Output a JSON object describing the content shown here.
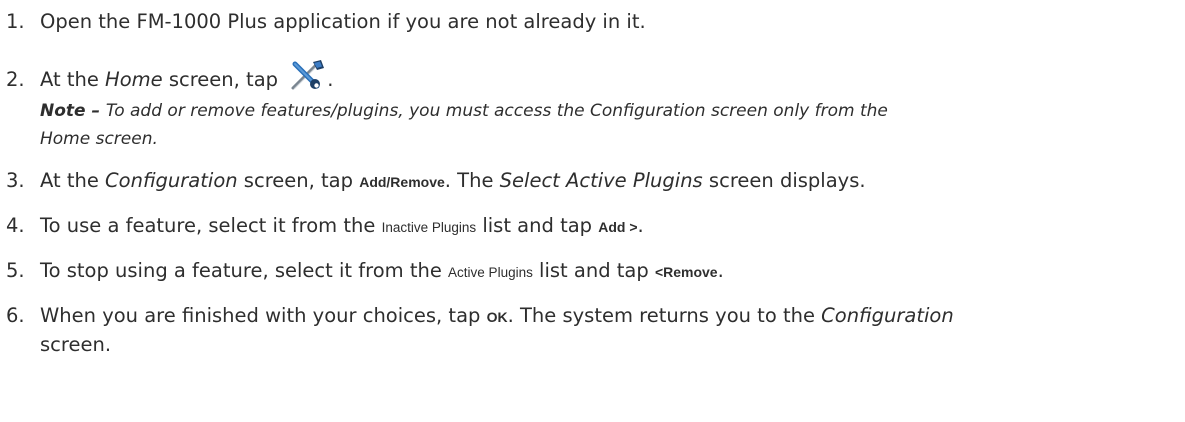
{
  "steps": [
    {
      "number": "1.",
      "text": "Open the FM-1000 Plus application if you are not already in it."
    },
    {
      "number": "2.",
      "before": "At the ",
      "screen": "Home",
      "after": " screen, tap ",
      "icon": "wrench-screwdriver-icon",
      "end": "."
    },
    {
      "number": "3.",
      "before": "At the ",
      "screen": "Configuration",
      "middle": " screen, tap ",
      "button": "Add/Remove",
      "mid2": ". The ",
      "screen2": "Select Active Plugins",
      "after": " screen displays."
    },
    {
      "number": "4.",
      "before": "To use a feature, select it from the ",
      "list": "Inactive Plugins",
      "middle": " list and tap ",
      "button": "Add >",
      "end": "."
    },
    {
      "number": "5.",
      "before": "To stop using a feature, select it from the ",
      "list": "Active Plugins",
      "middle": " list and tap ",
      "button": "<Remove",
      "end": "."
    },
    {
      "number": "6.",
      "before": "When you are finished with your choices, tap ",
      "button": "OK",
      "middle": ". The system returns you to the ",
      "screen": "Configuration",
      "wrap": "screen."
    }
  ],
  "note": {
    "label": "Note",
    "dash": " – ",
    "line1": "To add or remove features/plugins, you must access the Configuration screen only from the",
    "line2": "Home screen."
  },
  "icon_colors": {
    "handle": "#2a6fb8",
    "shaft": "#7a8590",
    "tip": "#1e3f66"
  }
}
